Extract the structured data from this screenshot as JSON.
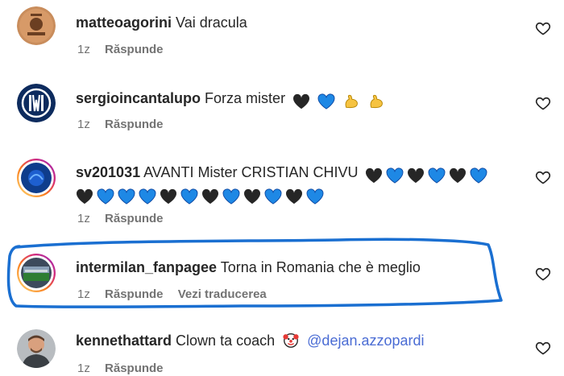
{
  "comments": [
    {
      "username": "matteoagorini",
      "text": "Vai dracula",
      "time": "1z",
      "reply_label": "Răspunde"
    },
    {
      "username": "sergioincantalupo",
      "text": "Forza mister",
      "time": "1z",
      "reply_label": "Răspunde",
      "emojis": [
        "black-heart",
        "blue-heart",
        "flexed-biceps",
        "flexed-biceps"
      ]
    },
    {
      "username": "sv201031",
      "text": "AVANTI Mister CRISTIAN CHIVU",
      "time": "1z",
      "reply_label": "Răspunde",
      "emojis_line1": [
        "black-heart",
        "blue-heart",
        "black-heart",
        "blue-heart",
        "black-heart",
        "blue-heart"
      ],
      "emojis_line2": [
        "black-heart",
        "blue-heart",
        "blue-heart",
        "blue-heart",
        "black-heart",
        "blue-heart",
        "black-heart",
        "blue-heart",
        "black-heart",
        "blue-heart",
        "black-heart",
        "blue-heart"
      ]
    },
    {
      "username": "intermilan_fanpagee",
      "text": "Torna in Romania che è meglio",
      "time": "1z",
      "reply_label": "Răspunde",
      "translate_label": "Vezi traducerea"
    },
    {
      "username": "kennethattard",
      "text": "Clown ta coach",
      "mention": "@dejan.azzopardi",
      "time": "1z",
      "reply_label": "Răspunde",
      "emojis": [
        "clown-face"
      ]
    }
  ],
  "colors": {
    "black_heart": "#262626",
    "blue_heart": "#1e88e5",
    "annotation": "#1a6fd1",
    "meta_text": "#737373",
    "mention": "#4a6cd4"
  },
  "icons": {
    "like": "heart-outline-icon"
  }
}
